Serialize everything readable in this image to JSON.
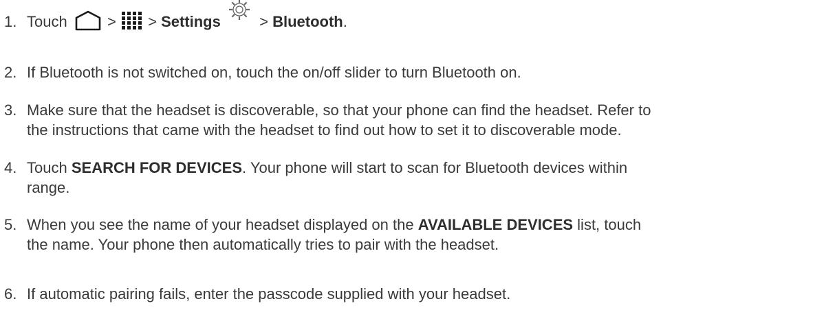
{
  "steps": [
    {
      "number": "1.",
      "pre": "Touch",
      "icons": [
        "home-icon",
        "apps-grid-icon",
        "settings-gear-icon"
      ],
      "sep": ">",
      "settings": "Settings",
      "bluetooth": "Bluetooth",
      "end": "."
    },
    {
      "number": "2.",
      "text": "If Bluetooth is not switched on, touch the on/off slider to turn Bluetooth on."
    },
    {
      "number": "3.",
      "line1": "Make sure that the headset is discoverable, so that your phone can find the headset. Refer to",
      "line2": "the instructions that came with the headset to find out how to set it to discoverable mode."
    },
    {
      "number": "4.",
      "pre": "Touch",
      "bold": "SEARCH FOR DEVICES",
      "post": ". Your phone will start to scan for Bluetooth devices within",
      "line2": "range."
    },
    {
      "number": "5.",
      "pre": "When you see the name of your headset displayed on the",
      "bold": "AVAILABLE DEVICES",
      "post": "list, touch",
      "line2": "the name. Your phone then automatically tries to pair with the headset."
    },
    {
      "number": "6.",
      "text": "If automatic pairing fails, enter the passcode supplied with your headset."
    }
  ],
  "colors": {
    "text": "#3a3a3a",
    "icon": "#1a1a1a"
  }
}
